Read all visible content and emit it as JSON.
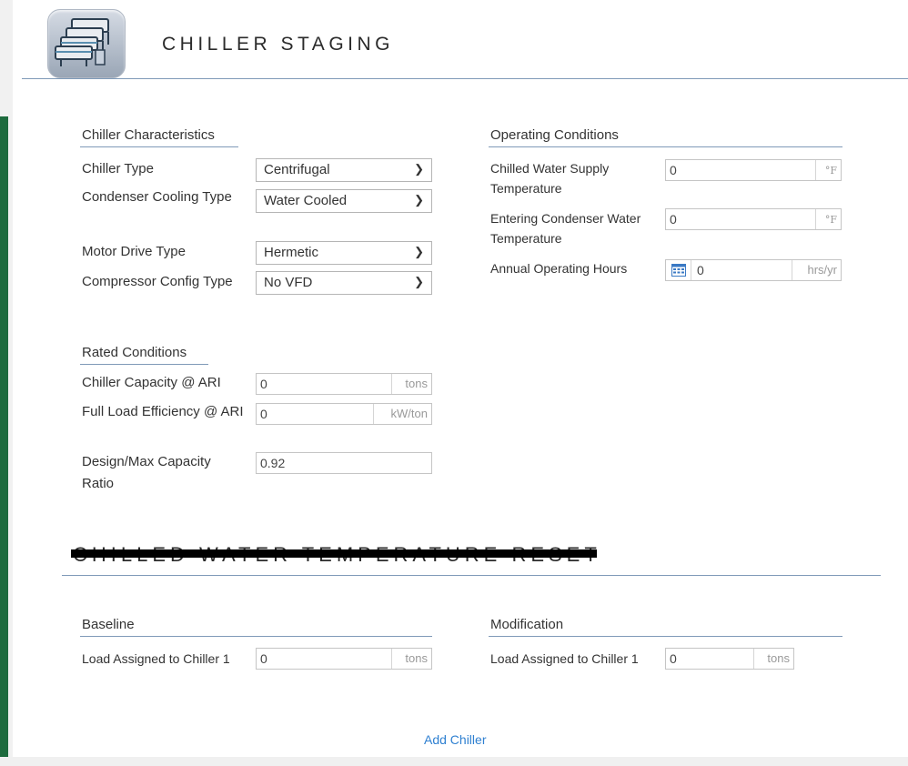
{
  "header": {
    "title": "CHILLER STAGING",
    "icon": "chiller-icon"
  },
  "chiller_characteristics": {
    "title": "Chiller Characteristics",
    "chiller_type": {
      "label": "Chiller Type",
      "value": "Centrifugal"
    },
    "condenser_cooling_type": {
      "label": "Condenser Cooling Type",
      "value": "Water Cooled"
    },
    "motor_drive_type": {
      "label": "Motor Drive Type",
      "value": "Hermetic"
    },
    "compressor_config_type": {
      "label": "Compressor Config Type",
      "value": "No VFD"
    }
  },
  "rated_conditions": {
    "title": "Rated Conditions",
    "capacity": {
      "label": "Chiller Capacity @ ARI",
      "value": "0",
      "unit": "tons"
    },
    "efficiency": {
      "label": "Full Load Efficiency @ ARI",
      "value": "0",
      "unit": "kW/ton"
    },
    "capacity_ratio": {
      "label": "Design/Max Capacity Ratio",
      "value": "0.92"
    }
  },
  "operating_conditions": {
    "title": "Operating Conditions",
    "chilled_water_supply": {
      "label": "Chilled Water Supply Temperature",
      "value": "0",
      "unit": "°F"
    },
    "entering_condenser": {
      "label": "Entering Condenser Water Temperature",
      "value": "0",
      "unit": "°F"
    },
    "annual_hours": {
      "label": "Annual Operating Hours",
      "value": "0",
      "unit": "hrs/yr"
    }
  },
  "reset_section": {
    "title": "CHILLED WATER TEMPERATURE RESET"
  },
  "baseline": {
    "title": "Baseline",
    "load": {
      "label": "Load Assigned to Chiller 1",
      "value": "0",
      "unit": "tons"
    }
  },
  "modification": {
    "title": "Modification",
    "load": {
      "label": "Load Assigned to Chiller 1",
      "value": "0",
      "unit": "tons"
    }
  },
  "actions": {
    "add_chiller": "Add Chiller"
  },
  "colors": {
    "accent_line": "#7f9ab8",
    "link": "#2f80d1",
    "side_bar": "#1d6b3e"
  }
}
